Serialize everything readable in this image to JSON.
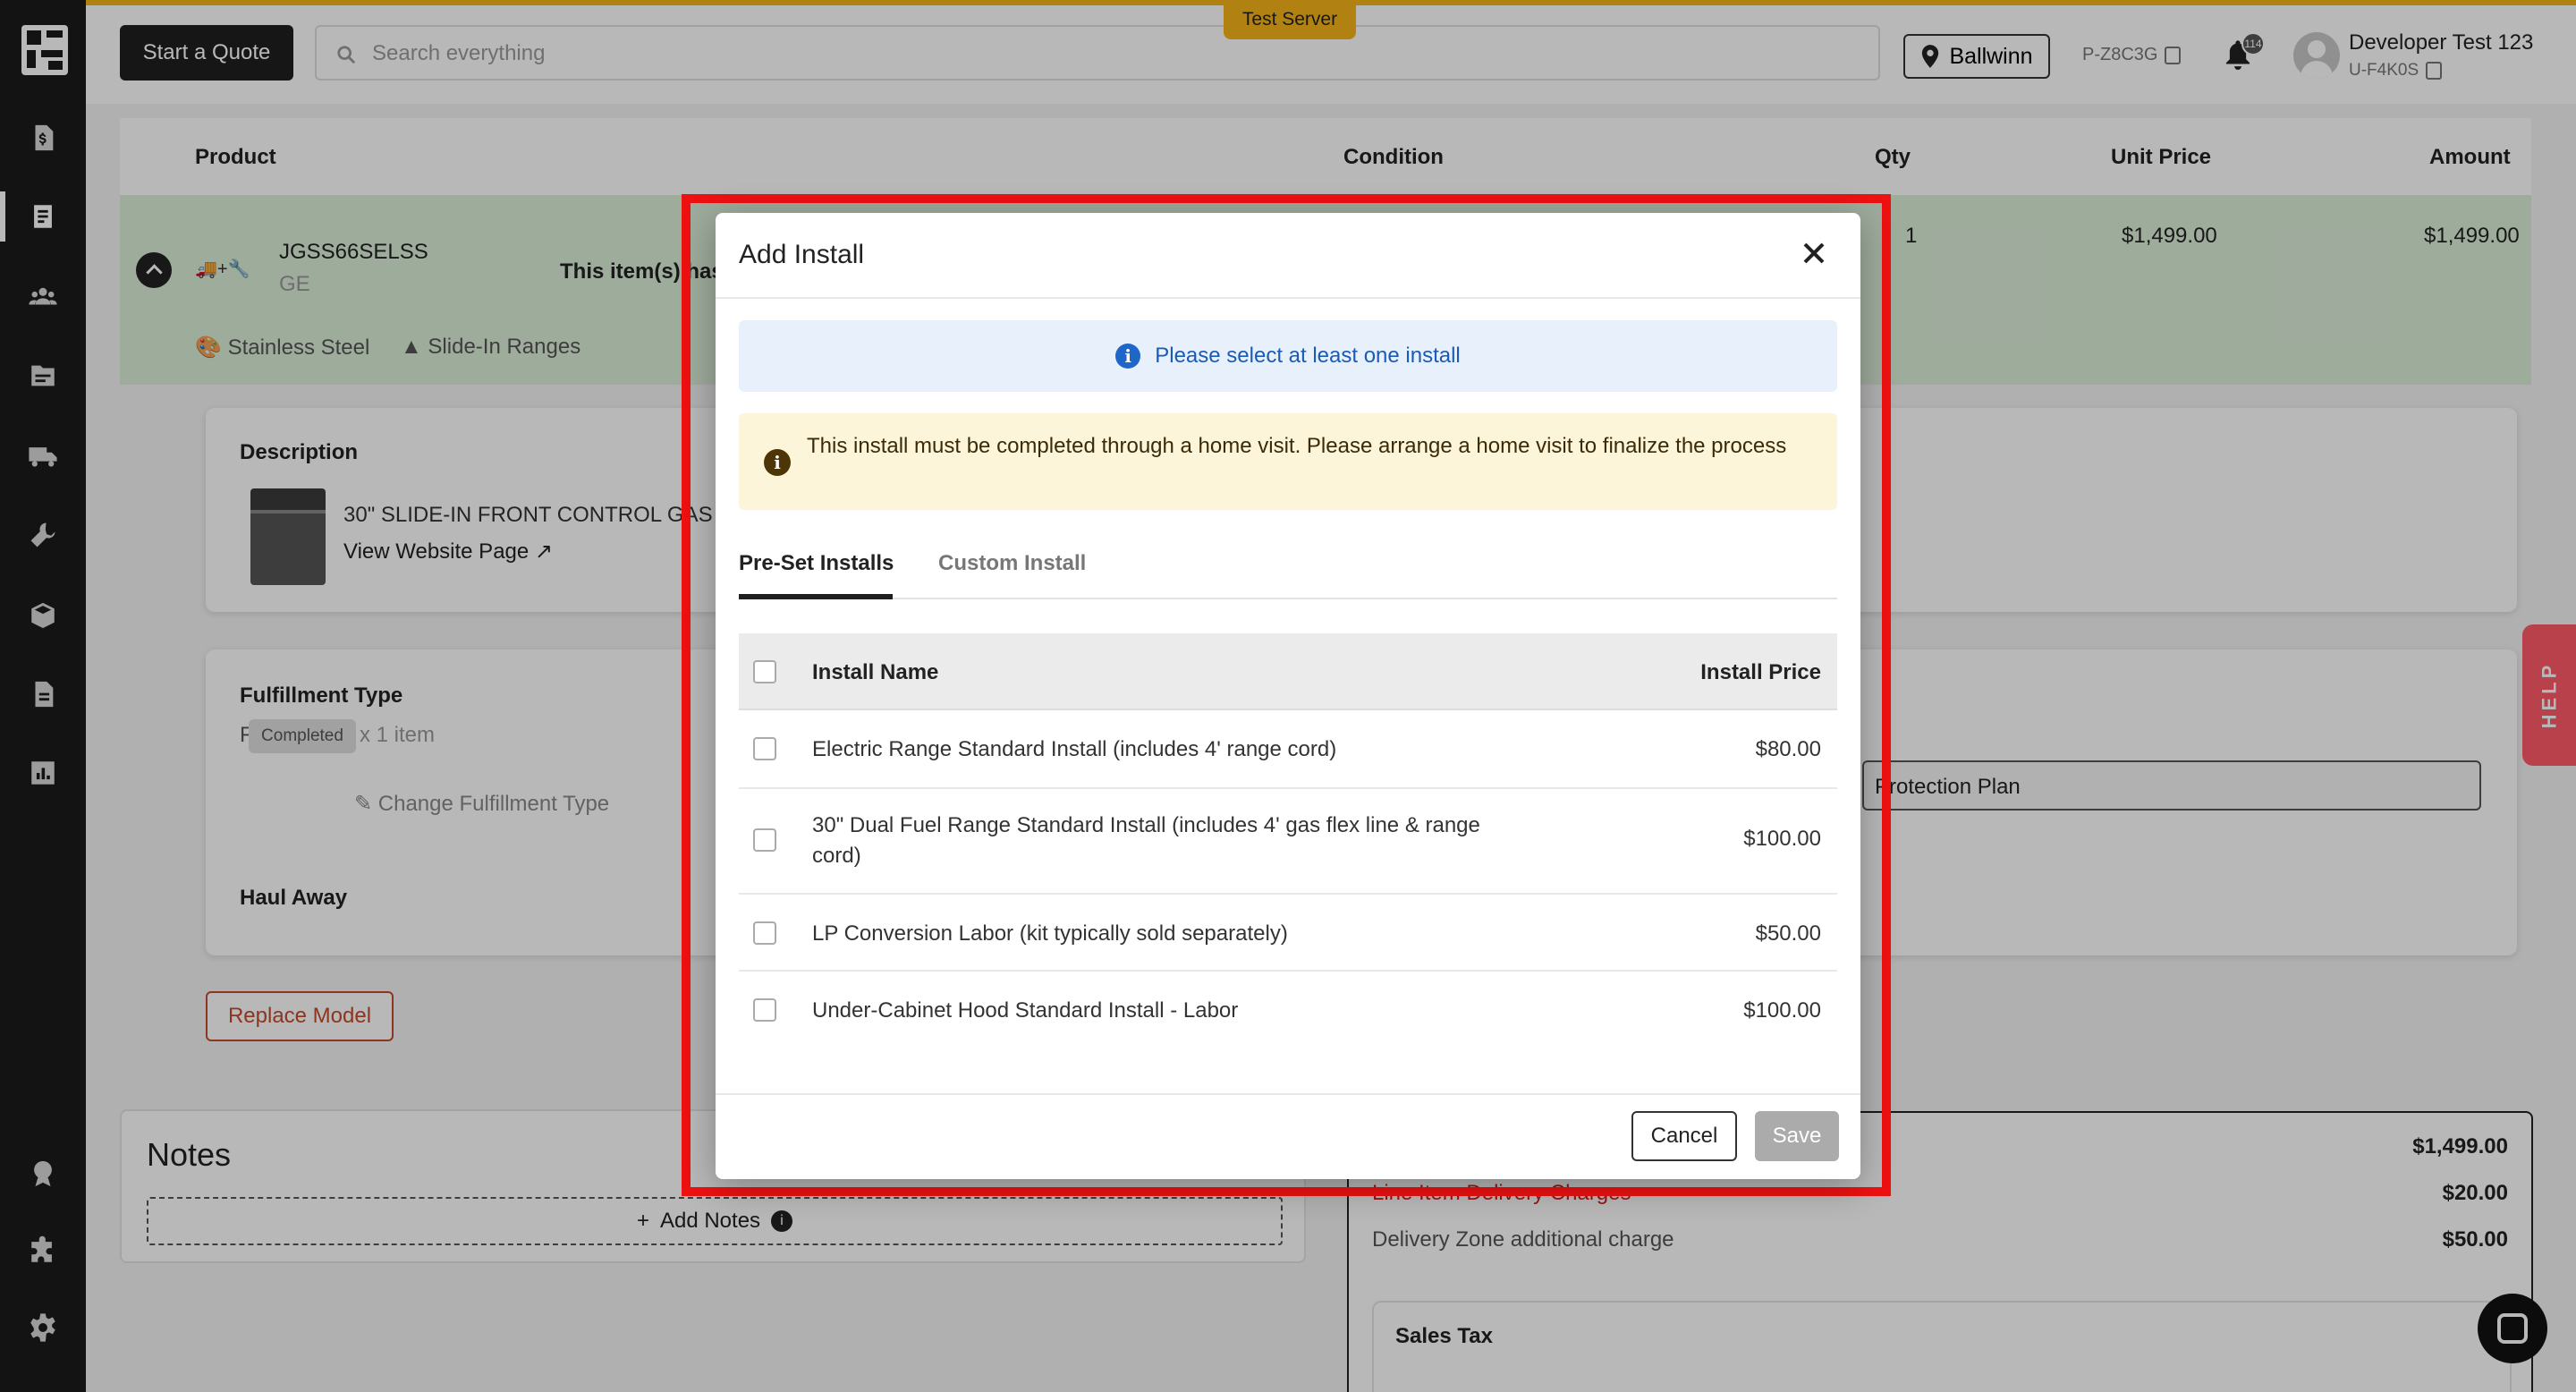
{
  "topbar": {
    "quote_button": "Start a Quote",
    "search_placeholder": "Search everything",
    "server_badge": "Test Server",
    "store": "Ballwinn",
    "profile_id": "P-Z8C3G",
    "notification_count": "114",
    "user_name": "Developer Test 123",
    "user_id": "U-F4K0S"
  },
  "sidebar": {
    "icons": [
      "logo-icon",
      "invoice-icon",
      "orders-icon",
      "customers-icon",
      "catalog-icon",
      "delivery-icon",
      "install-icon",
      "inventory-icon",
      "documents-icon",
      "reports-icon",
      "awards-icon",
      "integrations-icon",
      "settings-icon"
    ]
  },
  "order_table": {
    "headers": {
      "product": "Product",
      "condition": "Condition",
      "qty": "Qty",
      "unit_price": "Unit Price",
      "amount": "Amount"
    },
    "item": {
      "sku": "JGSS66SELSS",
      "brand": "GE",
      "note_partial": "This item(s) has",
      "qty": "1",
      "unit_price": "$1,499.00",
      "amount": "$1,499.00",
      "finish": "Stainless Steel",
      "category": "Slide-In Ranges"
    }
  },
  "description": {
    "label": "Description",
    "text_partial": "30\" SLIDE-IN FRONT CONTROL GAS R",
    "link": "View Website Page"
  },
  "fulfillment": {
    "label": "Fulfillment Type",
    "type": "Full-service",
    "qty_text": "x 1 item",
    "status": "Completed",
    "change_link": "Change Fulfillment Type",
    "haul_away": "Haul Away",
    "protection_plan_partial": "Protection Plan"
  },
  "replace_button": "Replace Model",
  "notes": {
    "title": "Notes",
    "add_button": "Add Notes"
  },
  "summary": {
    "subtotal": "$1,499.00",
    "line_delivery_label": "Line Item Delivery Charges",
    "line_delivery": "$20.00",
    "zone_label": "Delivery Zone additional charge",
    "zone": "$50.00",
    "sales_tax": "Sales Tax"
  },
  "help_tab": "HELP",
  "modal": {
    "title": "Add Install",
    "info_message": "Please select at least one install",
    "warning_message": "This install must be completed through a home visit. Please arrange a home visit to finalize the process",
    "tabs": [
      "Pre-Set Installs",
      "Custom Install"
    ],
    "columns": {
      "name": "Install Name",
      "price": "Install Price"
    },
    "installs": [
      {
        "name": "Electric Range Standard Install (includes 4' range cord)",
        "price": "$80.00"
      },
      {
        "name": "30\" Dual Fuel Range Standard Install (includes 4' gas flex line & range cord)",
        "price": "$100.00"
      },
      {
        "name": "LP Conversion Labor (kit typically sold separately)",
        "price": "$50.00"
      },
      {
        "name": "Under-Cabinet Hood Standard Install - Labor",
        "price": "$100.00"
      }
    ],
    "cancel": "Cancel",
    "save": "Save"
  }
}
